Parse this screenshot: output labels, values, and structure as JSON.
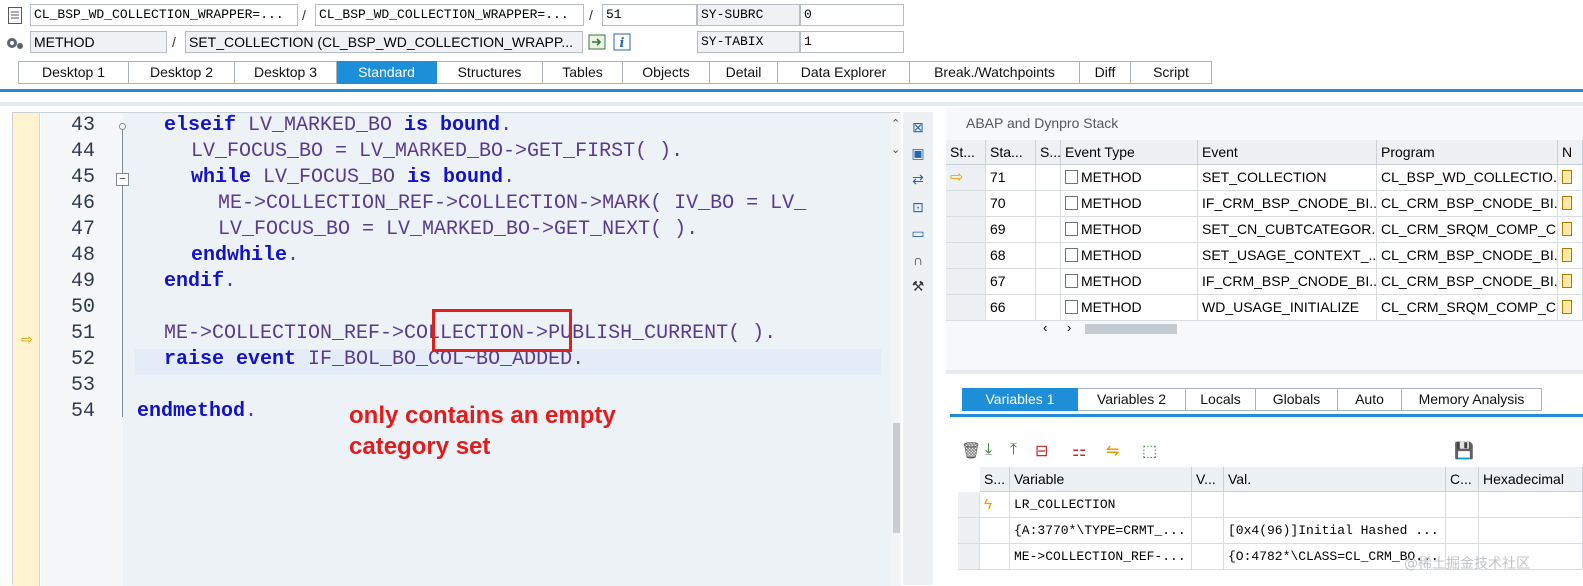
{
  "header": {
    "row1": {
      "field1": "CL_BSP_WD_COLLECTION_WRAPPER=...",
      "field2": "CL_BSP_WD_COLLECTION_WRAPPER=...",
      "field3": "51",
      "sys_label": "SY-SUBRC",
      "sys_value": "0",
      "sep": "/"
    },
    "row2": {
      "field1": "METHOD",
      "field2": "SET_COLLECTION (CL_BSP_WD_COLLECTION_WRAPP...",
      "sys_label": "SY-TABIX",
      "sys_value": "1",
      "sep": "/"
    }
  },
  "tabs": [
    "Desktop 1",
    "Desktop 2",
    "Desktop 3",
    "Standard",
    "Structures",
    "Tables",
    "Objects",
    "Detail",
    "Data Explorer",
    "Break./Watchpoints",
    "Diff",
    "Script"
  ],
  "active_tab": "Standard",
  "editor": {
    "lines": [
      {
        "n": "43",
        "code": [
          [
            "kw",
            "elseif"
          ],
          [
            "t",
            " LV_MARKED_BO "
          ],
          [
            "kw",
            "is bound"
          ],
          [
            "t",
            "."
          ]
        ],
        "indent": 1
      },
      {
        "n": "44",
        "code": [
          [
            "t",
            "LV_FOCUS_BO = LV_MARKED_BO->GET_FIRST( )."
          ]
        ],
        "indent": 2
      },
      {
        "n": "45",
        "code": [
          [
            "kw",
            "while"
          ],
          [
            "t",
            " LV_FOCUS_BO "
          ],
          [
            "kw",
            "is bound"
          ],
          [
            "t",
            "."
          ]
        ],
        "indent": 2
      },
      {
        "n": "46",
        "code": [
          [
            "t",
            "ME->COLLECTION_REF->COLLECTION->MARK( IV_BO = LV_"
          ]
        ],
        "indent": 3
      },
      {
        "n": "47",
        "code": [
          [
            "t",
            "LV_FOCUS_BO = LV_MARKED_BO->GET_NEXT( )."
          ]
        ],
        "indent": 3
      },
      {
        "n": "48",
        "code": [
          [
            "kw",
            "endwhile"
          ],
          [
            "t",
            "."
          ]
        ],
        "indent": 2
      },
      {
        "n": "49",
        "code": [
          [
            "kw",
            "endif"
          ],
          [
            "t",
            "."
          ]
        ],
        "indent": 1
      },
      {
        "n": "50",
        "code": [],
        "indent": 1
      },
      {
        "n": "51",
        "code": [
          [
            "t",
            "ME->COLLECTION_REF->COLLECTION->PUBLISH_CURRENT( )."
          ]
        ],
        "indent": 1
      },
      {
        "n": "52",
        "code": [
          [
            "kw",
            "raise event"
          ],
          [
            "t",
            " IF_BOL_BO_COL~BO_ADDED."
          ]
        ],
        "indent": 1
      },
      {
        "n": "53",
        "code": [],
        "indent": 1
      },
      {
        "n": "54",
        "code": [
          [
            "kw",
            "endmethod"
          ],
          [
            "t",
            "."
          ]
        ],
        "indent": 0
      }
    ]
  },
  "annotation": {
    "text_line1": "only contains an empty",
    "text_line2": "category set",
    "color": "#e21c1c"
  },
  "stack": {
    "title": "ABAP and Dynpro Stack",
    "columns": [
      "St...",
      "Sta...",
      "S...",
      "Event Type",
      "Event",
      "Program",
      "N"
    ],
    "rows": [
      {
        "level": "71",
        "type": "METHOD",
        "event": "SET_COLLECTION",
        "program": "CL_BSP_WD_COLLECTIO...",
        "current": true
      },
      {
        "level": "70",
        "type": "METHOD",
        "event": "IF_CRM_BSP_CNODE_BI...",
        "program": "CL_CRM_BSP_CNODE_BI...",
        "current": false
      },
      {
        "level": "69",
        "type": "METHOD",
        "event": "SET_CN_CUBTCATEGOR...",
        "program": "CL_CRM_SRQM_COMP_C...",
        "current": false
      },
      {
        "level": "68",
        "type": "METHOD",
        "event": "SET_USAGE_CONTEXT_...",
        "program": "CL_CRM_BSP_CNODE_BI...",
        "current": false
      },
      {
        "level": "67",
        "type": "METHOD",
        "event": "IF_CRM_BSP_CNODE_BI...",
        "program": "CL_CRM_BSP_CNODE_BI...",
        "current": false
      },
      {
        "level": "66",
        "type": "METHOD",
        "event": "WD_USAGE_INITIALIZE",
        "program": "CL_CRM_SRQM_COMP_C...",
        "current": false
      }
    ]
  },
  "variables": {
    "tabs": [
      "Variables 1",
      "Variables 2",
      "Locals",
      "Globals",
      "Auto",
      "Memory Analysis"
    ],
    "active_tab": "Variables 1",
    "columns": [
      "S...",
      "Variable",
      "V...",
      "Val.",
      "C...",
      "Hexadecimal"
    ],
    "rows": [
      {
        "variable": "LR_COLLECTION",
        "value": "",
        "icon": "lightning"
      },
      {
        "variable": "{A:3770*\\TYPE=CRMT_...",
        "value": "[0x4(96)]Initial Hashed ...",
        "icon": ""
      },
      {
        "variable": "ME->COLLECTION_REF-...",
        "value": "{O:4782*\\CLASS=CL_CRM_BO...",
        "icon": ""
      }
    ]
  },
  "watermark": "@稀土掘金技术社区"
}
